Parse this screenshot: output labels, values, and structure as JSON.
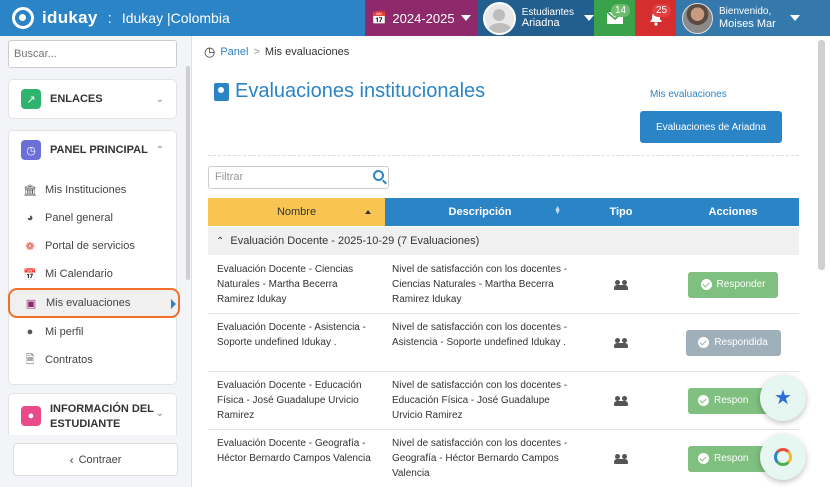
{
  "topbar": {
    "brand_logo": "idukay",
    "brand_separator": ":",
    "school": "Idukay |Colombia",
    "year": "2024-2025",
    "profile_role": "Estudiantes",
    "profile_name": "Ariadna",
    "messages_count": "14",
    "notifications_count": "25",
    "welcome": "Bienvenido,",
    "user_name": "Moises Mar"
  },
  "sidebar": {
    "search_placeholder": "Buscar...",
    "enlaces": "ENLACES",
    "panel_principal": "PANEL PRINCIPAL",
    "items": [
      {
        "label": "Mis Instituciones",
        "icon": "institution-icon"
      },
      {
        "label": "Panel general",
        "icon": "dashboard-icon"
      },
      {
        "label": "Portal de servicios",
        "icon": "services-icon"
      },
      {
        "label": "Mi Calendario",
        "icon": "calendar-icon"
      },
      {
        "label": "Mis evaluaciones",
        "icon": "evaluations-icon"
      },
      {
        "label": "Mi perfil",
        "icon": "user-icon"
      },
      {
        "label": "Contratos",
        "icon": "document-icon"
      }
    ],
    "info_estudiante_1": "INFORMACIÓN DEL",
    "info_estudiante_2": "ESTUDIANTE",
    "collapse": "Contraer"
  },
  "breadcrumb": {
    "home": "Panel",
    "separator": ">",
    "current": "Mis evaluaciones"
  },
  "page": {
    "title": "Evaluaciones institucionales",
    "link_mis_evaluaciones": "Mis evaluaciones",
    "button_evaluaciones_ariadna": "Evaluaciones de Ariadna",
    "filter_placeholder": "Filtrar"
  },
  "table": {
    "headers": [
      "Nombre",
      "Descripción",
      "Tipo",
      "Acciones"
    ],
    "group_label": "Evaluación Docente - 2025-10-29 (7 Evaluaciones)",
    "rows": [
      {
        "nombre": "Evaluación Docente - Ciencias Naturales - Martha Becerra Ramirez Idukay",
        "descripcion": "Nivel de satisfacción con los docentes - Ciencias Naturales - Martha Becerra Ramirez Idukay",
        "accion": "Responder"
      },
      {
        "nombre": "Evaluación Docente - Asistencia - Soporte undefined Idukay .",
        "descripcion": "Nivel de satisfacción con los docentes - Asistencia - Soporte undefined Idukay .",
        "accion": "Respondida"
      },
      {
        "nombre": "Evaluación Docente - Educación Física - José Guadalupe Urvicio Ramirez",
        "descripcion": "Nivel de satisfacción con los docentes - Educación Física - José Guadalupe Urvicio Ramirez",
        "accion": "Respon"
      },
      {
        "nombre": "Evaluación Docente - Geografía - Héctor Bernardo Campos Valencia",
        "descripcion": "Nivel de satisfacción con los docentes - Geografía - Héctor Bernardo Campos Valencia",
        "accion": "Respon"
      }
    ]
  },
  "colors": {
    "primary": "#2b84c6",
    "year_bg": "#8e2a6c",
    "messages_bg": "#3aa24a",
    "notifications_bg": "#d42e2e",
    "active_outline": "#f26e2a",
    "nombre_header": "#f9c552",
    "respond_button": "#7fbf7f",
    "responded_button": "#9fb0bb"
  }
}
